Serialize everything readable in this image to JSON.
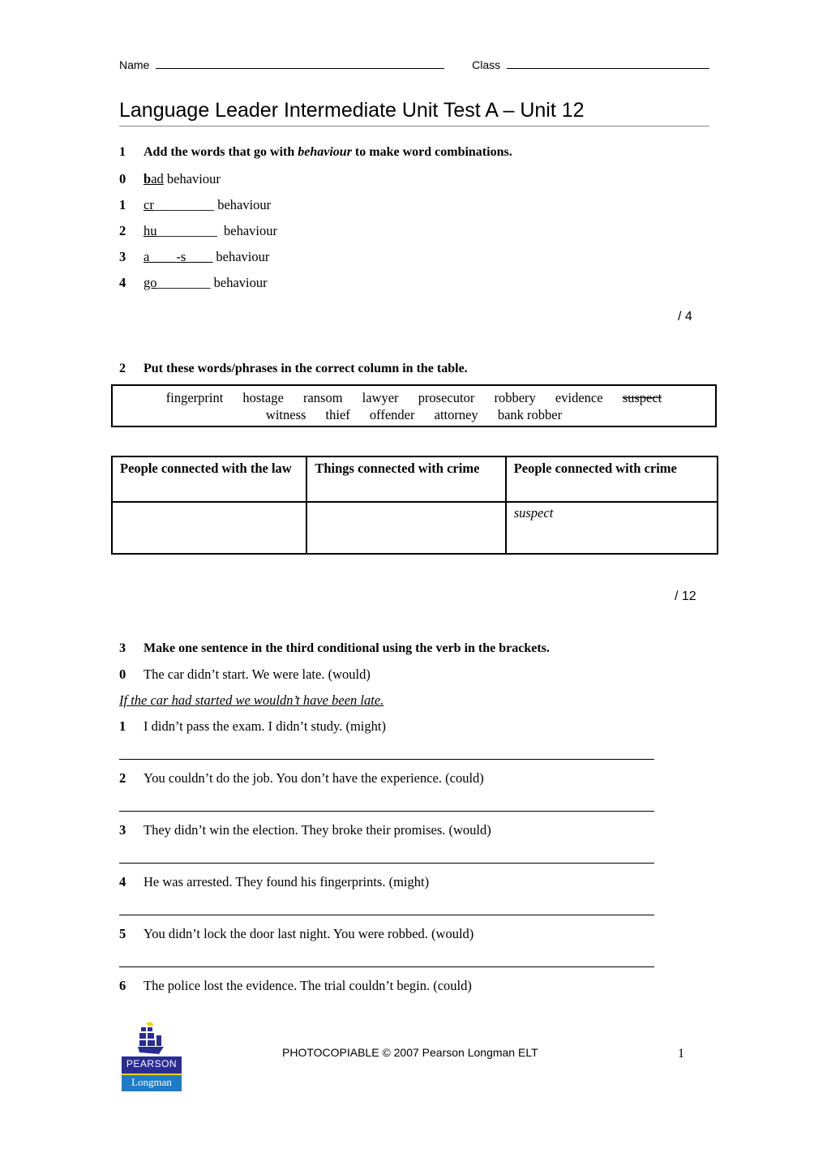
{
  "header": {
    "name_label": "Name",
    "class_label": "Class"
  },
  "title": "Language Leader Intermediate Unit Test A – Unit 12",
  "section1": {
    "number": "1",
    "instruction_pre": "Add the words that go with ",
    "instruction_em": "behaviour",
    "instruction_post": " to make word combinations.",
    "items": [
      {
        "number": "0",
        "prefix_bold": "b",
        "prefix": "ad",
        "blank": "",
        "suffix": " behaviour"
      },
      {
        "number": "1",
        "prefix_bold": "",
        "prefix": "cr",
        "blank": "_________",
        "suffix": " behaviour"
      },
      {
        "number": "2",
        "prefix_bold": "",
        "prefix": "hu",
        "blank": "_________",
        "suffix": "  behaviour"
      },
      {
        "number": "3",
        "prefix_bold": "",
        "prefix": "a____-s____",
        "blank": "",
        "suffix": " behaviour"
      },
      {
        "number": "4",
        "prefix_bold": "",
        "prefix": "go",
        "blank": "________",
        "suffix": " behaviour"
      }
    ],
    "score": "/ 4"
  },
  "section2": {
    "number": "2",
    "instruction": "Put these words/phrases in the correct column in the table.",
    "words_row1": [
      "fingerprint",
      "hostage",
      "ransom",
      "lawyer",
      "prosecutor",
      "robbery",
      "evidence"
    ],
    "struck_word": "suspect",
    "words_row2": [
      "witness",
      "thief",
      "offender",
      "attorney",
      "bank robber"
    ],
    "table": {
      "headers": [
        "People connected with the law",
        "Things connected with crime",
        "People connected with crime"
      ],
      "cells": [
        "",
        "",
        "suspect"
      ]
    },
    "score": "/ 12"
  },
  "section3": {
    "number": "3",
    "instruction": "Make one sentence in the third conditional using the verb in the brackets.",
    "example": {
      "number": "0",
      "text": "The car didn’t start. We were late. (would)",
      "answer": "If the car had started we wouldn’t have been late."
    },
    "items": [
      {
        "number": "1",
        "text": "I didn’t pass the exam. I didn’t study. (might)"
      },
      {
        "number": "2",
        "text": "You couldn’t do the job. You don’t have the experience. (could)"
      },
      {
        "number": "3",
        "text": "They didn’t win the election. They broke their promises. (would)"
      },
      {
        "number": "4",
        "text": "He was arrested. They found his fingerprints. (might)"
      },
      {
        "number": "5",
        "text": "You didn’t lock the door last night. You were robbed. (would)"
      },
      {
        "number": "6",
        "text": "The police lost the evidence. The trial couldn’t begin. (could)"
      }
    ]
  },
  "footer": {
    "copyright": "PHOTOCOPIABLE © 2007 Pearson Longman ELT",
    "page_number": "1",
    "logo_top": "PEARSON",
    "logo_bottom": "Longman",
    "colors": {
      "logo_navy": "#2a2d8f",
      "logo_blue": "#1f7cc4",
      "logo_yellow": "#f2d200"
    }
  }
}
